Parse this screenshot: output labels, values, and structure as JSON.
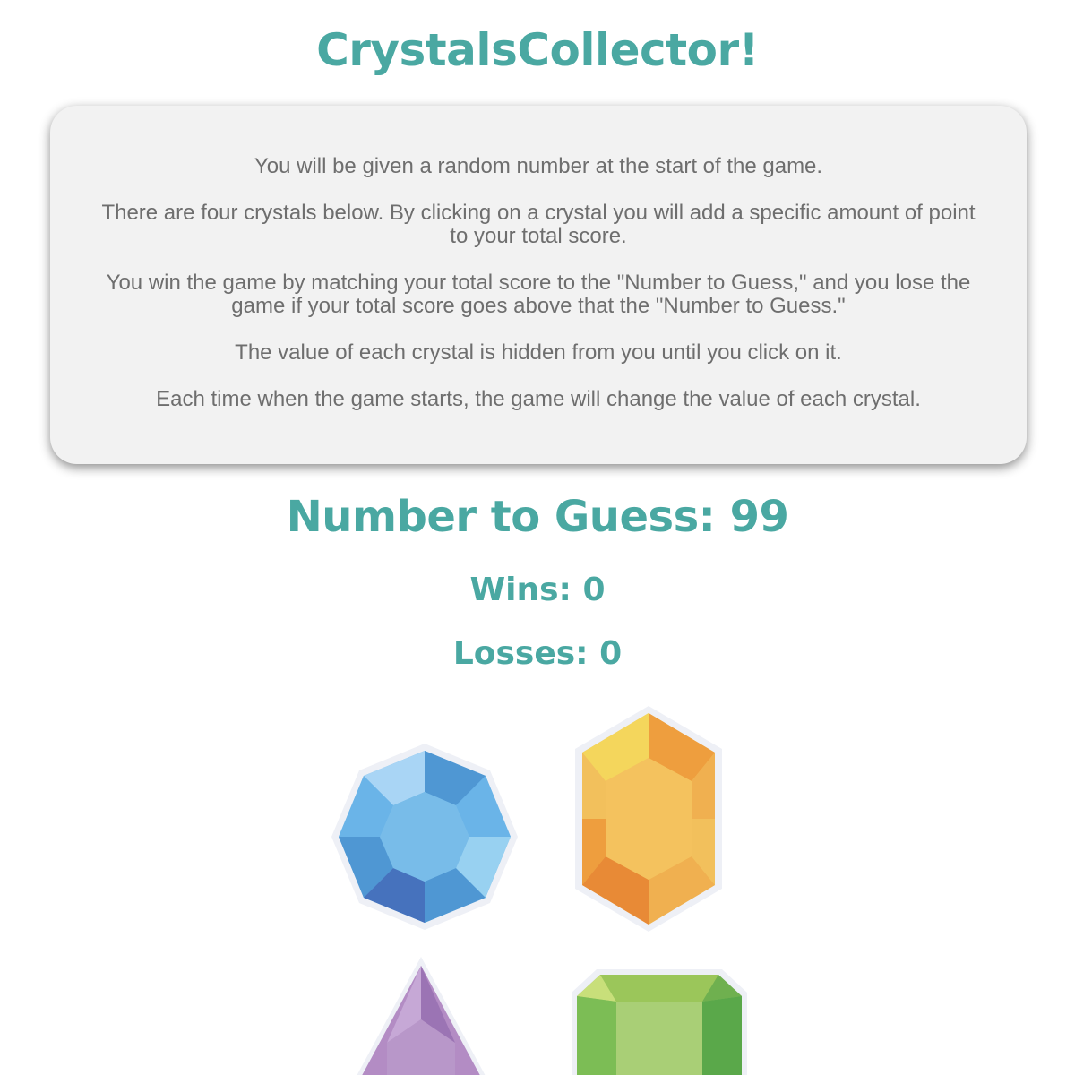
{
  "game": {
    "title": "CrystalsCollector!",
    "instructions": [
      "You will be given a random number at the start of the game.",
      "There are four crystals below. By clicking on a crystal you will add a specific amount of point to your total score.",
      "You win the game by matching your total score to the \"Number to Guess,\" and you lose the game if your total score goes above that the \"Number to Guess.\"",
      "The value of each crystal is hidden from you until you click on it.",
      "Each time when the game starts, the game will change the value of each crystal."
    ],
    "target_text": "Number to Guess: 99",
    "wins_text": "Wins: 0",
    "losses_text": "Losses: 0"
  },
  "colors": {
    "accent": "#4aa8a2",
    "panel_bg": "#f2f2f2",
    "body_text": "#6e6e6e"
  },
  "crystals": [
    {
      "name": "blue-octagon-gem-icon",
      "color": "#6ab4e8"
    },
    {
      "name": "orange-hexagon-gem-icon",
      "color": "#f2c05c"
    },
    {
      "name": "purple-triangle-gem-icon",
      "color": "#b38cc4"
    },
    {
      "name": "green-emerald-gem-icon",
      "color": "#8cc264"
    }
  ]
}
